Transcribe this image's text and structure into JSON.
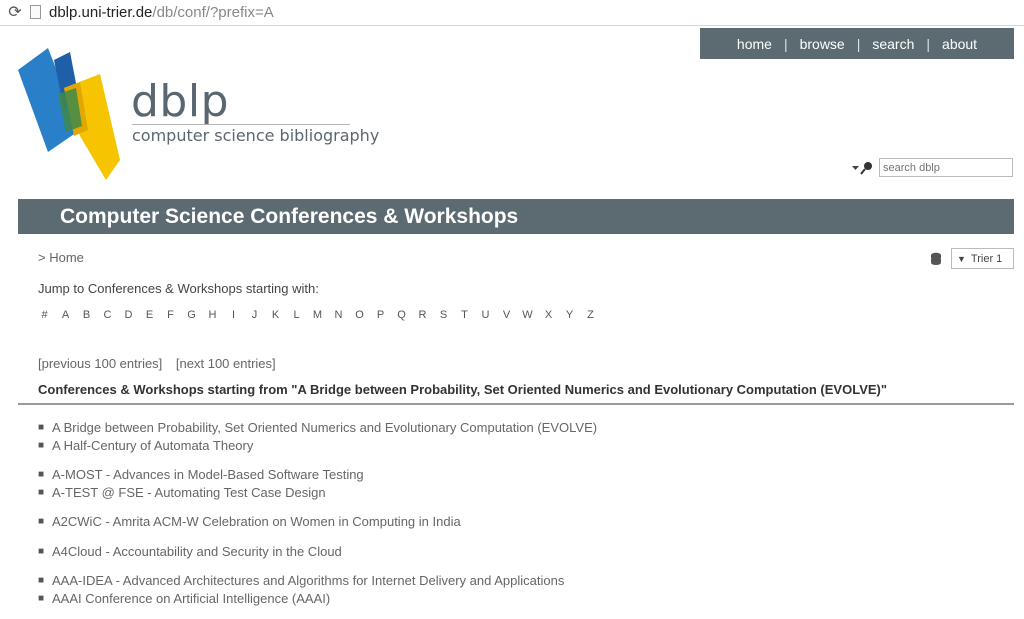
{
  "browser": {
    "url_host": "dblp.uni-trier.de",
    "url_path": "/db/conf/?prefix=A"
  },
  "topnav": {
    "home": "home",
    "browse": "browse",
    "search": "search",
    "about": "about",
    "sep": "|"
  },
  "logo": {
    "word": "dblp",
    "tagline": "computer science bibliography"
  },
  "search": {
    "placeholder": "search dblp"
  },
  "page": {
    "title": "Computer Science Conferences & Workshops",
    "breadcrumb": "> Home",
    "mirror_label": "Trier 1",
    "jump_label": "Jump to Conferences & Workshops starting with:",
    "letters": [
      "#",
      "A",
      "B",
      "C",
      "D",
      "E",
      "F",
      "G",
      "H",
      "I",
      "J",
      "K",
      "L",
      "M",
      "N",
      "O",
      "P",
      "Q",
      "R",
      "S",
      "T",
      "U",
      "V",
      "W",
      "X",
      "Y",
      "Z"
    ],
    "prev_label": "[previous 100 entries]",
    "next_label": "[next 100 entries]",
    "section_heading": "Conferences & Workshops starting from \"A Bridge between Probability, Set Oriented Numerics and Evolutionary Computation (EVOLVE)\""
  },
  "entry_groups": [
    [
      "A Bridge between Probability, Set Oriented Numerics and Evolutionary Computation (EVOLVE)",
      "A Half-Century of Automata Theory"
    ],
    [
      "A-MOST - Advances in Model-Based Software Testing",
      "A-TEST @ FSE - Automating Test Case Design"
    ],
    [
      "A2CWiC - Amrita ACM-W Celebration on Women in Computing in India"
    ],
    [
      "A4Cloud - Accountability and Security in the Cloud"
    ],
    [
      "AAA-IDEA - Advanced Architectures and Algorithms for Internet Delivery and Applications",
      "AAAI Conference on Artificial Intelligence (AAAI)"
    ]
  ],
  "colors": {
    "nav_bg": "#5c6a72",
    "logo_blue": "#2a7fc9",
    "logo_yellow": "#f6c400",
    "logo_text": "#5b6770"
  }
}
